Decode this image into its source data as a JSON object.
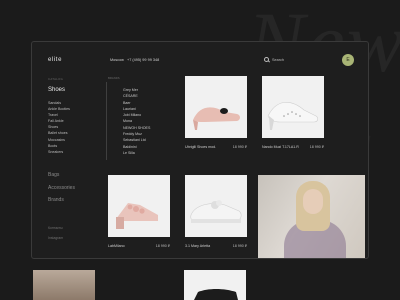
{
  "topbar": {
    "logo": "elite",
    "location": "Moscow",
    "phone": "+7 (495) 99 99 348",
    "search_label": "Search",
    "avatar_initial": "Е"
  },
  "sidebar": {
    "category_label": "CATALOG",
    "title": "Shoes",
    "items": [
      "Sandals",
      "Ankle Booties",
      "Travel",
      "Fall Ankle",
      "Shoes",
      "Ballet shoes",
      "Moccasins",
      "Boots",
      "Sneakers"
    ],
    "sections": [
      "Bags",
      "Accessories",
      "Brands"
    ],
    "footer": [
      "Контакты",
      "Instagram"
    ]
  },
  "subnav": {
    "label": "BRANDS",
    "items": [
      "Grey Mer",
      "CÉSARE",
      "Baer",
      "Lauriani",
      "Jobi Milano",
      "Mona",
      "NEWOH SHOES",
      "Freddy Muz",
      "Sebastiani Ltd",
      "Baldinini",
      "Le Silla"
    ]
  },
  "products": [
    {
      "name": "Ubriglli Shoes mod.",
      "price": "18 990 ₽"
    },
    {
      "name": "Nando Muzi T.17LA1.R",
      "price": "18 990 ₽"
    },
    {
      "name": "LabMilano",
      "price": "18 990 ₽"
    },
    {
      "name": "3.1 Mary Arletta",
      "price": "18 990 ₽"
    }
  ],
  "colors": {
    "background": "#1b1b1b",
    "accent": "#a8b475"
  }
}
